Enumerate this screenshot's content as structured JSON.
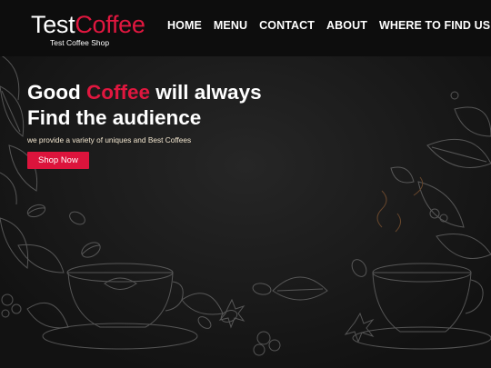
{
  "brand": {
    "name_part1": "Test",
    "name_part2": "Coffee",
    "subtitle": "Test Coffee Shop"
  },
  "nav": {
    "items": [
      "HOME",
      "MENU",
      "CONTACT",
      "ABOUT",
      "WHERE TO FIND US"
    ]
  },
  "hero": {
    "headline_part1": "Good",
    "headline_highlight": "Coffee",
    "headline_part2": "will always",
    "headline_line2": "Find the audience",
    "tagline": "we provide a variety of uniques and Best Coffees",
    "cta_label": "Shop Now"
  },
  "colors": {
    "accent": "#dc143c",
    "background": "#151515",
    "header": "#0d0d0d"
  }
}
